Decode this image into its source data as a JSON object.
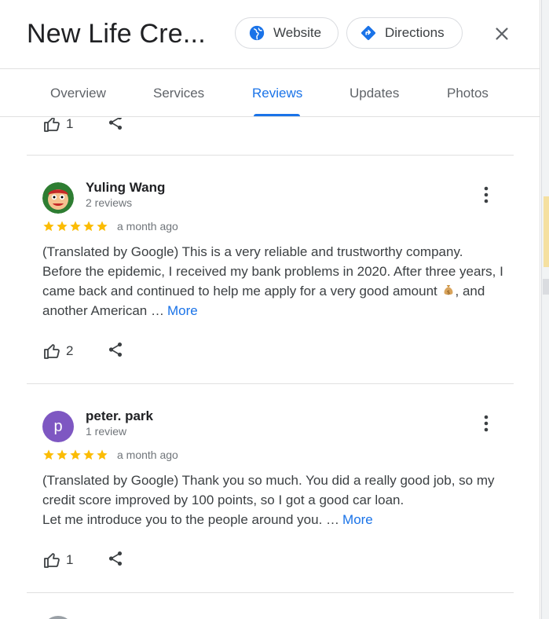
{
  "header": {
    "title": "New Life Cre...",
    "website_label": "Website",
    "directions_label": "Directions"
  },
  "tabs": [
    {
      "label": "Overview"
    },
    {
      "label": "Services"
    },
    {
      "label": "Reviews"
    },
    {
      "label": "Updates"
    },
    {
      "label": "Photos"
    }
  ],
  "active_tab": "Reviews",
  "previous_review": {
    "likes": "1"
  },
  "reviews": [
    {
      "name": "Yuling Wang",
      "review_count": "2 reviews",
      "rating": 5,
      "date": "a month ago",
      "text_before_emoji": "(Translated by Google) This is a very reliable and trustworthy company. Before the epidemic, I received my bank problems in 2020. After three years, I came back and continued to help me apply for a very good amount",
      "text_after_emoji": ", and another American …",
      "more_label": "More",
      "likes": "2"
    },
    {
      "name": "peter. park",
      "avatar_letter": "p",
      "review_count": "1 review",
      "rating": 5,
      "date": "a month ago",
      "text_line1": "(Translated by Google) Thank you so much. You did a really good job, so my credit score improved by 100 points, so I got a good car loan.",
      "text_line2": "Let me introduce you to the people around you. …",
      "more_label": "More",
      "likes": "1"
    }
  ],
  "colors": {
    "accent": "#1a73e8",
    "star": "#fbbc04",
    "avatar_purple": "#7e57c2"
  }
}
